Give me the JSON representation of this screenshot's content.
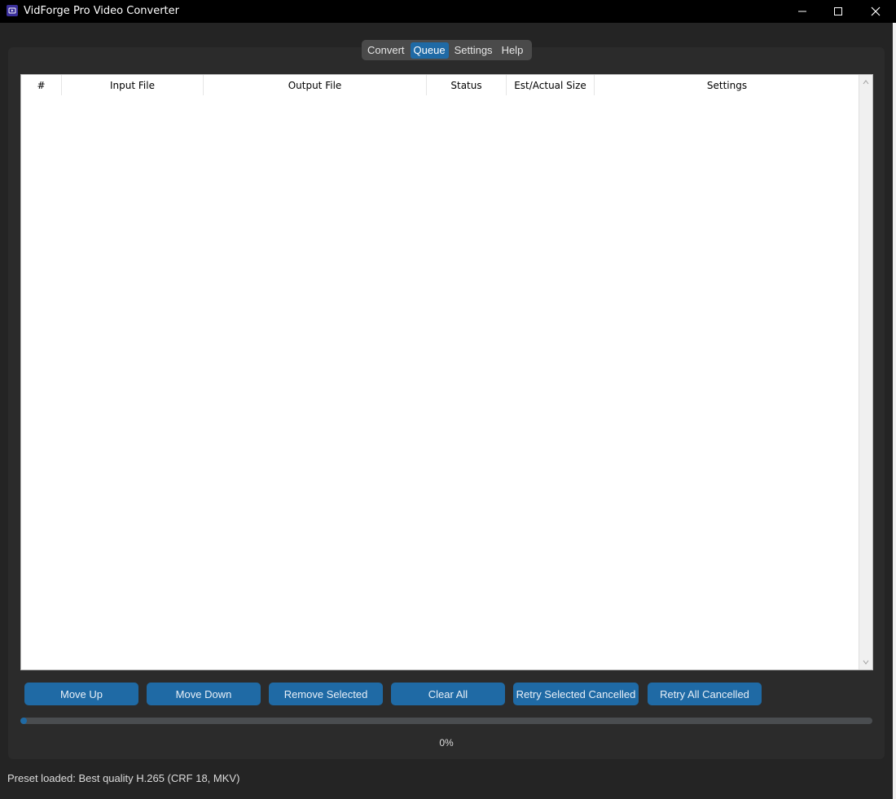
{
  "window": {
    "title": "VidForge Pro Video Converter",
    "icon": "app-logo-icon",
    "controls": [
      "minimize-icon",
      "maximize-icon",
      "close-icon"
    ]
  },
  "tabs": [
    {
      "label": "Convert",
      "active": false
    },
    {
      "label": "Queue",
      "active": true
    },
    {
      "label": "Settings",
      "active": false
    },
    {
      "label": "Help",
      "active": false
    }
  ],
  "queue_table": {
    "columns": [
      "#",
      "Input File",
      "Output File",
      "Status",
      "Est/Actual Size",
      "Settings"
    ],
    "rows": []
  },
  "actions": {
    "move_up": "Move Up",
    "move_down": "Move Down",
    "remove_selected": "Remove Selected",
    "clear_all": "Clear All",
    "retry_selected": "Retry Selected Cancelled",
    "retry_all": "Retry All Cancelled"
  },
  "progress": {
    "value": 0,
    "label": "0%"
  },
  "status_bar": {
    "text": "Preset loaded: Best quality H.265 (CRF 18, MKV)"
  },
  "colors": {
    "accent": "#1f6aa5",
    "background": "#242424",
    "panel": "#2b2b2b",
    "titlebar": "#000000"
  }
}
